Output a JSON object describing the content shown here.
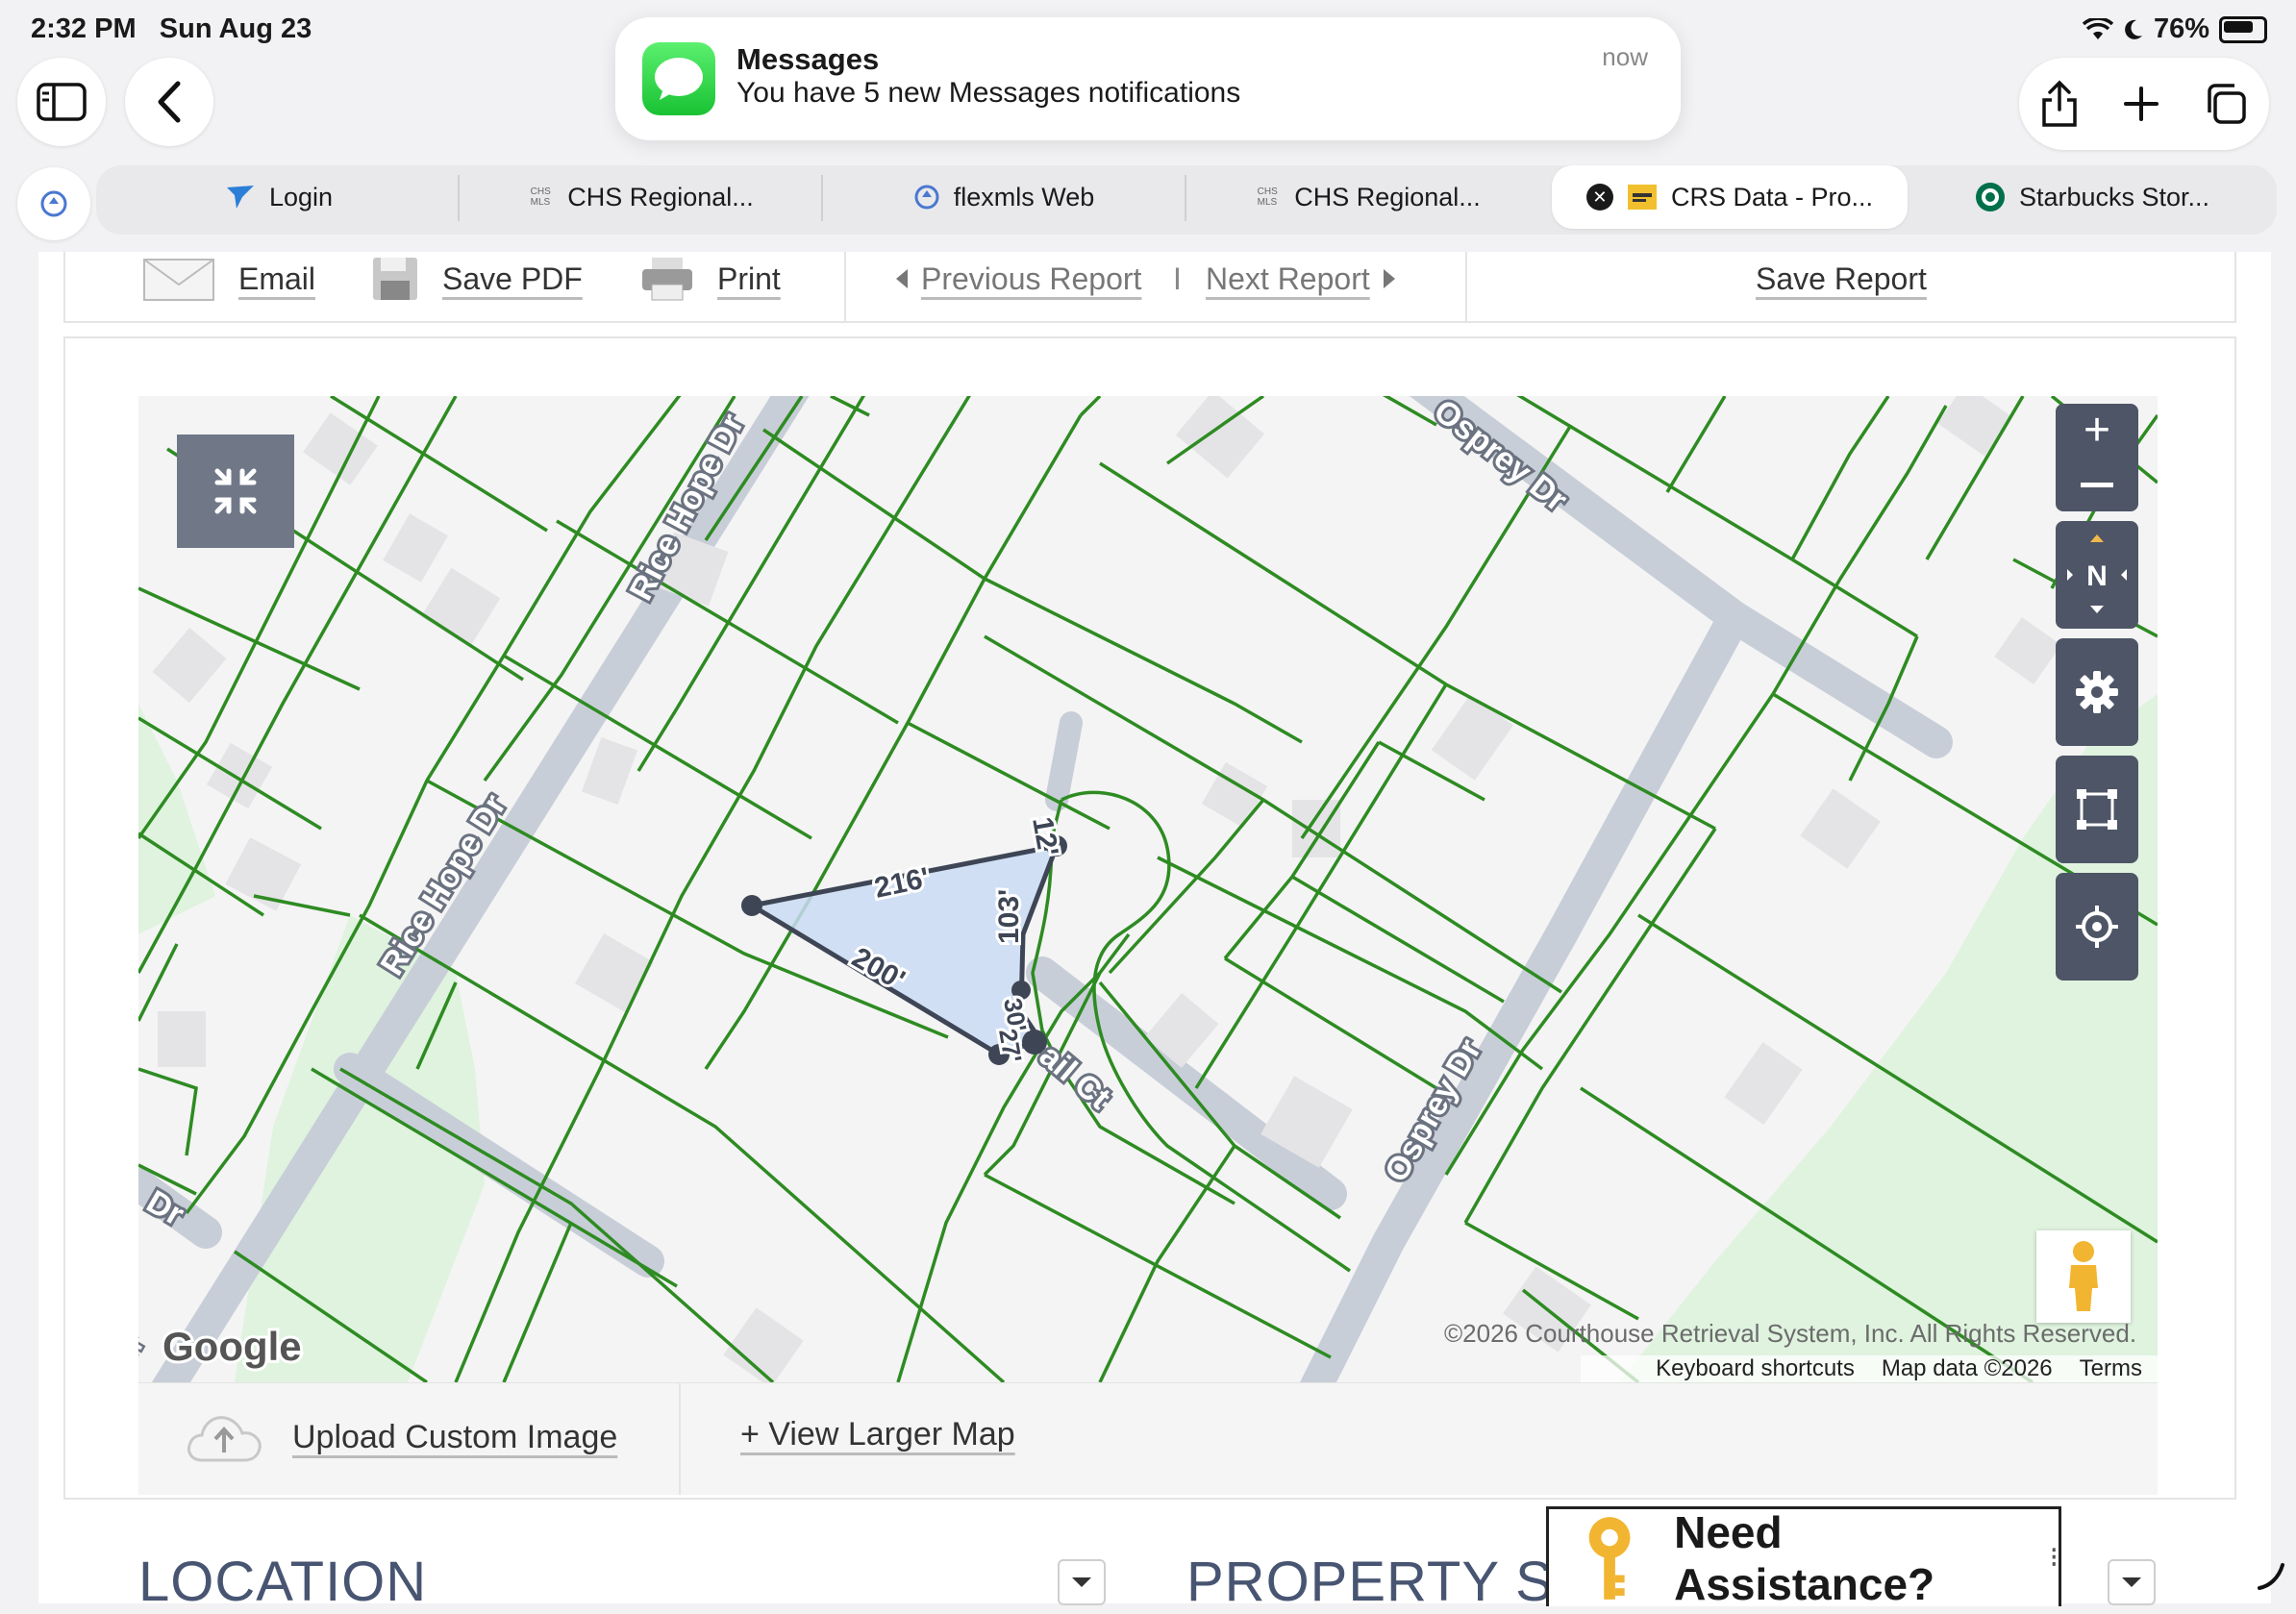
{
  "status_bar": {
    "time": "2:32 PM",
    "date": "Sun Aug 23",
    "battery": "76%"
  },
  "notification": {
    "app": "Messages",
    "body": "You have 5 new Messages notifications",
    "time": "now"
  },
  "tabs": [
    {
      "label": "Login",
      "icon": "flexmls-bird-icon"
    },
    {
      "label": "CHS Regional...",
      "icon": "chs-mls-icon"
    },
    {
      "label": "flexmls Web",
      "icon": "flexmls-pin-icon"
    },
    {
      "label": "CHS Regional...",
      "icon": "chs-mls-icon"
    },
    {
      "label": "CRS Data - Pro...",
      "icon": "crs-data-icon",
      "active": true
    },
    {
      "label": "Starbucks Stor...",
      "icon": "starbucks-icon"
    }
  ],
  "report_toolbar": {
    "email": "Email",
    "save_pdf": "Save PDF",
    "print": "Print",
    "previous_report": "Previous Report",
    "separator": "I",
    "next_report": "Next Report",
    "save_report": "Save Report"
  },
  "map": {
    "streets": {
      "rice_hope_upper": "Rice Hope Dr",
      "rice_hope_lower": "Rice Hope Dr",
      "osprey_upper": "Osprey Dr",
      "osprey_lower": "Osprey Dr",
      "court": "ail Ct",
      "dr_left": "Dr",
      "left_edge": "Dr"
    },
    "measurements": {
      "m1": "216'",
      "m2": "200'",
      "m3": "103'",
      "m4": "12'",
      "m5": "30'",
      "m6": "27'"
    },
    "google_logo": "Google",
    "copyright": "©2026 Courthouse Retrieval System, Inc. All Rights Reserved.",
    "keyboard_shortcuts": "Keyboard shortcuts",
    "map_data": "Map data ©2026",
    "terms": "Terms",
    "compass": "N"
  },
  "map_bottom": {
    "upload": "Upload Custom Image",
    "view_larger": "+ View Larger Map"
  },
  "sections": {
    "location": "LOCATION",
    "property_summary": "PROPERTY SU"
  },
  "assist": {
    "label": "Need Assistance?"
  },
  "colors": {
    "lot_line": "#2e8b22",
    "road": "#c8ced8",
    "park": "#dff3df",
    "parcel_fill": "#c9dbf3",
    "parcel_outline": "#3e4656",
    "control": "#4d5566"
  }
}
